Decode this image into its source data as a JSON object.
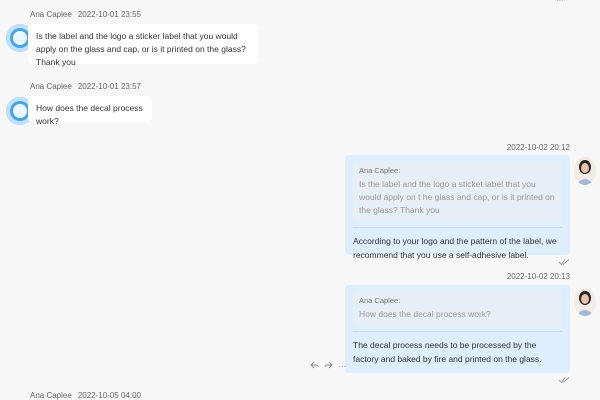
{
  "chat": {
    "messages": [
      {
        "sender": "Ana Caplee",
        "time": "2022-10-01 23:55",
        "text": "Is the label and the logo a sticker label that you would apply on the glass and cap, or is it printed on the glass? Thank you"
      },
      {
        "sender": "Ana Caplee",
        "time": "2022-10-01 23:57",
        "text": "How does the decal process work?"
      },
      {
        "time": "2022-10-02 20:12",
        "quote_name": "Ana Caplee:",
        "quote_text": "Is the label and the logo a sticket label that you would apply on t he glass and cap, or is it printed on the glass? Thank you",
        "text": "According to your logo and the pattern of the label, we recommend that you use a self-adhesive label."
      },
      {
        "time": "2022-10-02 20:13",
        "quote_name": "Ana Caplee:",
        "quote_text": "How does the decal process work?",
        "text": "The decal process needs to be processed by the factory and baked by fire and printed on the glass."
      },
      {
        "sender": "Ana Caplee",
        "time": "2022-10-05 04:00"
      }
    ]
  },
  "icons": {
    "read_receipt": "read-receipt-icon",
    "reply": "reply-icon",
    "forward": "forward-icon",
    "more": "more-icon",
    "more_top": "more-icon"
  }
}
